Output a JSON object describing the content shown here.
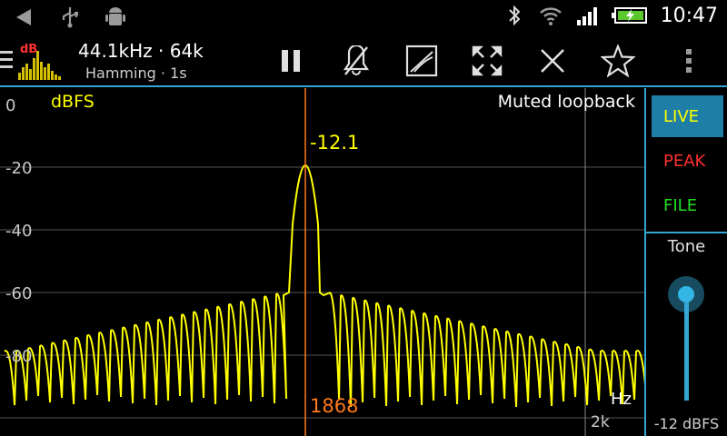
{
  "status_bar": {
    "time": "10:47",
    "left_icons": [
      "back-arrow-icon",
      "usb-icon",
      "android-debug-icon"
    ],
    "right_icons": [
      "bluetooth-icon",
      "wifi-icon",
      "signal-icon",
      "battery-icon"
    ]
  },
  "toolbar": {
    "app_icon_label": "dB",
    "title": "44.1kHz · 64k",
    "subtitle": "Hamming · 1s",
    "buttons": [
      "pause-icon",
      "mute-icon",
      "scale-icon",
      "fullscreen-icon",
      "close-icon",
      "star-icon",
      "overflow-menu-icon"
    ]
  },
  "plot": {
    "unit_label": "dBFS",
    "source_label": "Muted loopback",
    "y_ticks": [
      "0",
      "-20",
      "-40",
      "-60",
      "-80"
    ],
    "peak_value": "-12.1",
    "cursor_frequency": "1868",
    "x_unit": "Hz",
    "x_tick": "2k"
  },
  "side_panel": {
    "modes": [
      "LIVE",
      "PEAK",
      "FILE"
    ],
    "active_mode": "LIVE",
    "tone_label": "Tone",
    "tone_value": "-12 dBFS"
  },
  "colors": {
    "accent": "#33a6d3",
    "trace": "#ffff00",
    "cursor": "#ff7a1a",
    "live": "#1e7ea6",
    "peak": "#ff3030",
    "file": "#20e020"
  }
}
